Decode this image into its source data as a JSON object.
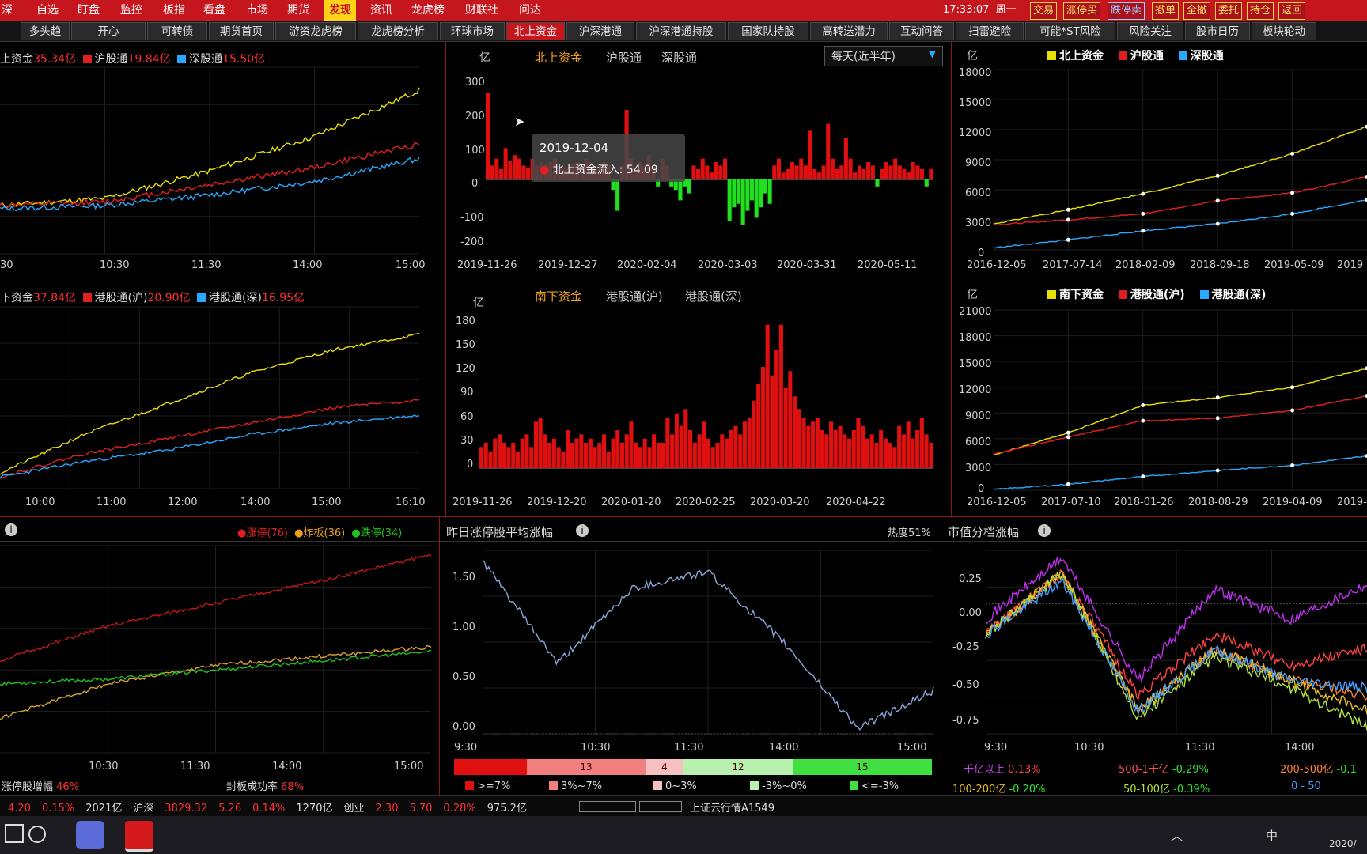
{
  "menubar": {
    "items": [
      "深",
      "自选",
      "盯盘",
      "监控",
      "板指",
      "看盘",
      "市场",
      "期货",
      "发现",
      "资讯",
      "龙虎榜",
      "财联社",
      "问达"
    ],
    "active_index": 8,
    "clock": "17:33:07",
    "weekday": "周一",
    "quick_buttons": [
      "交易",
      "涨停买",
      "跌停卖",
      "撤单",
      "全撤",
      "委托",
      "持仓",
      "返回"
    ]
  },
  "tabs": [
    "多头趋",
    "开心",
    "可转债",
    "期货首页",
    "游资龙虎榜",
    "龙虎榜分析",
    "环球市场",
    "北上资金",
    "沪深港通",
    "沪深港通持股",
    "国家队持股",
    "高转送潜力",
    "互动问答",
    "扫雷避险",
    "可能*ST风险",
    "风险关注",
    "股市日历",
    "板块轮动"
  ],
  "active_tab_index": 7,
  "panel_north_intraday": {
    "legend": [
      {
        "prefix": "上资金",
        "value": "35.34亿",
        "color": "#e8e000"
      },
      {
        "prefix": "沪股通",
        "value": "19.84亿",
        "color": "#e02020"
      },
      {
        "prefix": "深股通",
        "value": "15.50亿",
        "color": "#29a8ff"
      }
    ],
    "x_ticks": [
      "30",
      "10:30",
      "11:30",
      "14:00",
      "15:00"
    ]
  },
  "panel_south_intraday": {
    "legend": [
      {
        "prefix": "下资金",
        "value": "37.84亿",
        "color": "#e8e000"
      },
      {
        "prefix": "港股通(沪)",
        "value": "20.90亿",
        "color": "#e02020"
      },
      {
        "prefix": "港股通(深)",
        "value": "16.95亿",
        "color": "#29a8ff"
      }
    ],
    "x_ticks": [
      "10:00",
      "11:00",
      "12:00",
      "14:00",
      "15:00",
      "16:10"
    ]
  },
  "panel_north_daily": {
    "tabs": [
      "北上资金",
      "沪股通",
      "深股通"
    ],
    "unit": "亿",
    "dropdown": "每天(近半年)",
    "y_ticks": [
      "300",
      "200",
      "100",
      "0",
      "-100",
      "-200"
    ],
    "x_ticks": [
      "2019-11-26",
      "2019-12-27",
      "2020-02-04",
      "2020-03-03",
      "2020-03-31",
      "2020-05-11"
    ],
    "tooltip": {
      "date": "2019-12-04",
      "label": "北上资金流入:",
      "value": "54.09"
    }
  },
  "panel_south_daily": {
    "tabs": [
      "南下资金",
      "港股通(沪)",
      "港股通(深)"
    ],
    "unit": "亿",
    "y_ticks": [
      "180",
      "150",
      "120",
      "90",
      "60",
      "30",
      "0"
    ],
    "x_ticks": [
      "2019-11-26",
      "2019-12-20",
      "2020-01-20",
      "2020-02-25",
      "2020-03-20",
      "2020-04-22"
    ]
  },
  "panel_north_cum": {
    "unit": "亿",
    "legend": [
      {
        "name": "北上资金",
        "color": "#e8e000"
      },
      {
        "name": "沪股通",
        "color": "#e02020"
      },
      {
        "name": "深股通",
        "color": "#29a8ff"
      }
    ],
    "y_ticks": [
      "18000",
      "15000",
      "12000",
      "9000",
      "6000",
      "3000",
      "0"
    ],
    "x_ticks": [
      "2016-12-05",
      "2017-07-14",
      "2018-02-09",
      "2018-09-18",
      "2019-05-09",
      "2019"
    ]
  },
  "panel_south_cum": {
    "unit": "亿",
    "legend": [
      {
        "name": "南下资金",
        "color": "#e8e000"
      },
      {
        "name": "港股通(沪)",
        "color": "#e02020"
      },
      {
        "name": "港股通(深)",
        "color": "#29a8ff"
      }
    ],
    "y_ticks": [
      "21000",
      "18000",
      "15000",
      "12000",
      "9000",
      "6000",
      "3000",
      "0"
    ],
    "x_ticks": [
      "2016-12-05",
      "2017-07-10",
      "2018-01-26",
      "2018-08-29",
      "2019-04-09",
      "2019-1"
    ]
  },
  "panel_limit": {
    "legend": [
      {
        "name": "涨停(76)",
        "color": "#e02020"
      },
      {
        "name": "炸板(36)",
        "color": "#e8a020"
      },
      {
        "name": "跌停(34)",
        "color": "#20c020"
      }
    ],
    "x_ticks": [
      "10:30",
      "11:30",
      "14:00",
      "15:00"
    ],
    "footer_left_label": "涨停股增幅",
    "footer_left_value": "46%",
    "footer_right_label": "封板成功率",
    "footer_right_value": "68%"
  },
  "panel_yesterday": {
    "title": "昨日涨停股平均涨幅",
    "heat": "热度51%",
    "y_ticks": [
      "1.50",
      "1.00",
      "0.50",
      "0.00"
    ],
    "x_ticks": [
      "9:30",
      "10:30",
      "11:30",
      "14:00",
      "15:00"
    ],
    "dist": [
      {
        "count": "",
        "color": "#e01010"
      },
      {
        "count": "13",
        "color": "#f08080"
      },
      {
        "count": "4",
        "color": "#f6c0c0"
      },
      {
        "count": "12",
        "color": "#b8f0b0"
      },
      {
        "count": "15",
        "color": "#40e040"
      }
    ],
    "dist_legend": [
      ">=7%",
      "3%~7%",
      "0~3%",
      "-3%~0%",
      "<=-3%"
    ]
  },
  "panel_cap": {
    "title": "市值分档涨幅",
    "y_ticks": [
      "0.25",
      "0.00",
      "-0.25",
      "-0.50",
      "-0.75"
    ],
    "x_ticks": [
      "9:30",
      "10:30",
      "11:30",
      "14:00"
    ],
    "rows": [
      [
        {
          "name": "千亿以上",
          "value": "0.13%",
          "name_color": "#d040f0",
          "value_color": "#ff4040"
        },
        {
          "name": "500-1千亿",
          "value": "-0.29%",
          "name_color": "#ff5050",
          "value_color": "#30e030"
        },
        {
          "name": "200-500亿",
          "value": "-0.1",
          "name_color": "#ff8030",
          "value_color": "#30e030"
        }
      ],
      [
        {
          "name": "100-200亿",
          "value": "-0.20%",
          "name_color": "#e8c020",
          "value_color": "#30e030"
        },
        {
          "name": "50-100亿",
          "value": "-0.39%",
          "name_color": "#b0e040",
          "value_color": "#30e030"
        },
        {
          "name": "0 - 50",
          "value": "",
          "name_color": "#40a0ff",
          "value_color": "#30e030"
        }
      ]
    ]
  },
  "footer": {
    "items": [
      {
        "text": "4.20",
        "color": "#ff3030"
      },
      {
        "text": "0.15%",
        "color": "#ff3030"
      },
      {
        "text": "2021亿",
        "color": "#dddddd"
      },
      {
        "text": "沪深",
        "color": "#dddddd"
      },
      {
        "text": "3829.32",
        "color": "#ff3030"
      },
      {
        "text": "5.26",
        "color": "#ff3030"
      },
      {
        "text": "0.14%",
        "color": "#ff3030"
      },
      {
        "text": "1270亿",
        "color": "#dddddd"
      },
      {
        "text": "创业",
        "color": "#dddddd"
      },
      {
        "text": "2.30",
        "color": "#ff3030"
      },
      {
        "text": "5.70",
        "color": "#ff3030"
      },
      {
        "text": "0.28%",
        "color": "#ff3030"
      },
      {
        "text": "975.2亿",
        "color": "#dddddd"
      }
    ],
    "ticker": "上证云行情A1549"
  },
  "taskbar": {
    "ime": "中",
    "date": "2020/"
  },
  "chart_data": [
    {
      "type": "line",
      "title": "北上资金 (intraday)",
      "ylim": [
        0,
        40
      ],
      "x": [
        "9:30",
        "10:30",
        "11:30",
        "14:00",
        "15:00"
      ],
      "series": [
        {
          "name": "北上资金",
          "values": [
            2,
            4,
            12,
            22,
            35.34
          ]
        },
        {
          "name": "沪股通",
          "values": [
            2,
            3,
            8,
            13,
            19.84
          ]
        },
        {
          "name": "深股通",
          "values": [
            1,
            2,
            5,
            9,
            15.5
          ]
        }
      ]
    },
    {
      "type": "line",
      "title": "南下资金 (intraday)",
      "x": [
        "10:00",
        "11:00",
        "12:00",
        "14:00",
        "15:00",
        "16:10"
      ],
      "series": [
        {
          "name": "南下资金",
          "values": [
            2,
            12,
            20,
            28,
            34,
            37.84
          ]
        },
        {
          "name": "港股通(沪)",
          "values": [
            1,
            7,
            11,
            15,
            19,
            20.9
          ]
        },
        {
          "name": "港股通(深)",
          "values": [
            1,
            5,
            8,
            12,
            15,
            16.95
          ]
        }
      ]
    },
    {
      "type": "bar",
      "title": "北上资金 daily",
      "ylim": [
        -200,
        300
      ],
      "values": [
        250,
        40,
        60,
        30,
        90,
        54.09,
        70,
        60,
        40,
        35,
        60,
        40,
        50,
        45,
        50,
        60,
        40,
        35,
        30,
        45,
        50,
        40,
        60,
        50,
        30,
        45,
        50,
        40,
        -30,
        -90,
        40,
        200,
        60,
        30,
        50,
        40,
        70,
        40,
        -20,
        60,
        40,
        -20,
        -30,
        -60,
        -20,
        -40,
        40,
        30,
        60,
        40,
        20,
        50,
        40,
        60,
        -120,
        -80,
        -70,
        -130,
        -90,
        -60,
        -110,
        -80,
        -40,
        -70,
        40,
        60,
        20,
        30,
        50,
        40,
        60,
        40,
        140,
        30,
        20,
        40,
        160,
        60,
        30,
        40,
        120,
        60,
        20,
        40,
        30,
        50,
        40,
        -20,
        30,
        50,
        40,
        60,
        40,
        30,
        20,
        50,
        40,
        30,
        -20,
        30
      ]
    },
    {
      "type": "bar",
      "title": "南下资金 daily",
      "ylim": [
        0,
        180
      ],
      "values": [
        25,
        30,
        20,
        35,
        40,
        30,
        25,
        30,
        20,
        35,
        40,
        25,
        55,
        60,
        40,
        30,
        35,
        25,
        20,
        45,
        30,
        35,
        40,
        30,
        35,
        25,
        30,
        40,
        20,
        35,
        45,
        30,
        40,
        55,
        30,
        25,
        35,
        25,
        40,
        30,
        30,
        60,
        40,
        65,
        50,
        70,
        45,
        30,
        40,
        55,
        35,
        25,
        30,
        40,
        35,
        45,
        50,
        40,
        55,
        60,
        80,
        100,
        120,
        170,
        110,
        140,
        170,
        95,
        115,
        85,
        70,
        60,
        50,
        55,
        60,
        45,
        40,
        55,
        45,
        50,
        40,
        35,
        45,
        60,
        50,
        35,
        40,
        30,
        45,
        35,
        30,
        25,
        50,
        40,
        55,
        35,
        45,
        60,
        40,
        30
      ]
    },
    {
      "type": "line",
      "title": "北上资金 cumulative",
      "ylim": [
        0,
        18000
      ],
      "x": [
        "2016-12-05",
        "2017-07-14",
        "2018-02-09",
        "2018-09-18",
        "2019-05-09"
      ],
      "series": [
        {
          "name": "北上资金",
          "values": [
            2600,
            4000,
            5600,
            7400,
            9600,
            12300
          ]
        },
        {
          "name": "沪股通",
          "values": [
            2500,
            3000,
            3600,
            4900,
            5700,
            7300
          ]
        },
        {
          "name": "深股通",
          "values": [
            200,
            1000,
            1900,
            2600,
            3600,
            5000
          ]
        }
      ]
    },
    {
      "type": "line",
      "title": "南下资金 cumulative",
      "ylim": [
        0,
        21000
      ],
      "x": [
        "2016-12-05",
        "2017-07-10",
        "2018-01-26",
        "2018-08-29",
        "2019-04-09"
      ],
      "series": [
        {
          "name": "南下资金",
          "values": [
            4100,
            6700,
            9900,
            10800,
            12000,
            14200
          ]
        },
        {
          "name": "港股通(沪)",
          "values": [
            4200,
            6200,
            8100,
            8400,
            9300,
            11000
          ]
        },
        {
          "name": "港股通(深)",
          "values": [
            100,
            700,
            1600,
            2300,
            2900,
            4000
          ]
        }
      ]
    },
    {
      "type": "line",
      "title": "涨停/炸板/跌停",
      "x": [
        "9:30",
        "10:30",
        "11:30",
        "14:00",
        "15:00"
      ],
      "series": [
        {
          "name": "涨停",
          "values": [
            30,
            45,
            55,
            65,
            76
          ]
        },
        {
          "name": "炸板",
          "values": [
            5,
            20,
            28,
            32,
            36
          ]
        },
        {
          "name": "跌停",
          "values": [
            20,
            22,
            26,
            30,
            34
          ]
        }
      ]
    },
    {
      "type": "line",
      "title": "昨日涨停股平均涨幅",
      "ylim": [
        0,
        1.7
      ],
      "x": [
        "9:30",
        "10:30",
        "11:30",
        "14:00",
        "15:00"
      ],
      "series": [
        {
          "name": "昨日涨停股平均涨幅",
          "values": [
            1.6,
            0.65,
            1.35,
            1.5,
            0.85,
            0.05,
            0.4
          ]
        }
      ]
    },
    {
      "type": "line",
      "title": "市值分档涨幅",
      "ylim": [
        -0.85,
        0.35
      ],
      "x": [
        "9:30",
        "10:30",
        "11:30",
        "14:00"
      ],
      "series": [
        {
          "name": "千亿以上",
          "values": [
            -0.1,
            0.3,
            -0.5,
            0.1,
            -0.1,
            0.13
          ]
        },
        {
          "name": "500-1千亿",
          "values": [
            -0.2,
            0.2,
            -0.6,
            -0.2,
            -0.4,
            -0.29
          ]
        },
        {
          "name": "200-500亿",
          "values": [
            -0.2,
            0.2,
            -0.7,
            -0.3,
            -0.5,
            -0.6
          ]
        },
        {
          "name": "100-200亿",
          "values": [
            -0.2,
            0.2,
            -0.7,
            -0.3,
            -0.5,
            -0.7
          ]
        },
        {
          "name": "50-100亿",
          "values": [
            -0.2,
            0.2,
            -0.75,
            -0.35,
            -0.55,
            -0.8
          ]
        },
        {
          "name": "0-50亿",
          "values": [
            -0.2,
            0.15,
            -0.7,
            -0.3,
            -0.5,
            -0.55
          ]
        }
      ]
    }
  ]
}
